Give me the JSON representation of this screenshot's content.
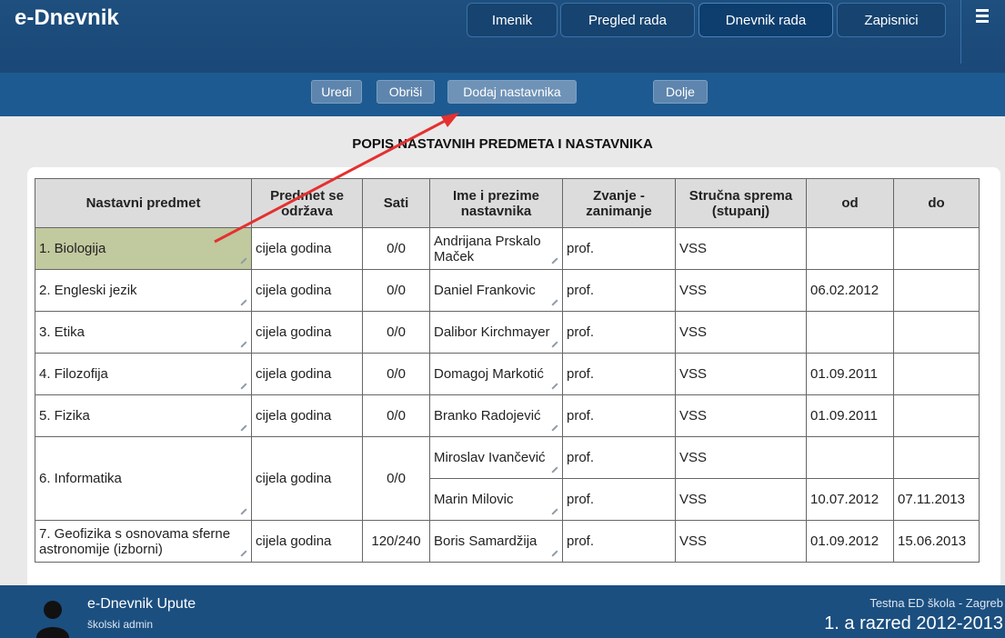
{
  "app": {
    "title": "e-Dnevnik"
  },
  "nav": {
    "imenik": "Imenik",
    "pregled": "Pregled rada",
    "dnevnik": "Dnevnik rada",
    "zapisnici": "Zapisnici"
  },
  "toolbar": {
    "uredi": "Uredi",
    "obrisi": "Obriši",
    "dodaj": "Dodaj nastavnika",
    "dolje": "Dolje"
  },
  "page": {
    "title": "POPIS NASTAVNIH PREDMETA I NASTAVNIKA"
  },
  "table": {
    "headers": [
      "Nastavni predmet",
      "Predmet se održava",
      "Sati",
      "Ime i prezime nastavnika",
      "Zvanje - zanimanje",
      "Stručna sprema (stupanj)",
      "od",
      "do"
    ],
    "rows": [
      {
        "subject": "1. Biologija",
        "held": "cijela godina",
        "hours": "0/0",
        "teacher": "Andrijana Prskalo Maček",
        "title": "prof.",
        "degree": "VSS",
        "from": "",
        "to": ""
      },
      {
        "subject": "2. Engleski jezik",
        "held": "cijela godina",
        "hours": "0/0",
        "teacher": "Daniel Frankovic",
        "title": "prof.",
        "degree": "VSS",
        "from": "06.02.2012",
        "to": ""
      },
      {
        "subject": "3. Etika",
        "held": "cijela godina",
        "hours": "0/0",
        "teacher": "Dalibor Kirchmayer",
        "title": "prof.",
        "degree": "VSS",
        "from": "",
        "to": ""
      },
      {
        "subject": "4. Filozofija",
        "held": "cijela godina",
        "hours": "0/0",
        "teacher": "Domagoj Markotić",
        "title": "prof.",
        "degree": "VSS",
        "from": "01.09.2011",
        "to": ""
      },
      {
        "subject": "5. Fizika",
        "held": "cijela godina",
        "hours": "0/0",
        "teacher": "Branko Radojević",
        "title": "prof.",
        "degree": "VSS",
        "from": "01.09.2011",
        "to": ""
      },
      {
        "subject": "6. Informatika",
        "held": "cijela godina",
        "hours": "0/0",
        "teacher": "Miroslav Ivančević",
        "title": "prof.",
        "degree": "VSS",
        "from": "",
        "to": ""
      },
      {
        "teacher": "Marin Milovic",
        "title": "prof.",
        "degree": "VSS",
        "from": "10.07.2012",
        "to": "07.11.2013"
      },
      {
        "subject": "7. Geofizika s osnovama sferne astronomije (izborni)",
        "held": "cijela godina",
        "hours": "120/240",
        "teacher": "Boris Samardžija",
        "title": "prof.",
        "degree": "VSS",
        "from": "01.09.2012",
        "to": "15.06.2013"
      }
    ]
  },
  "footer": {
    "title": "e-Dnevnik Upute",
    "user": "školski admin",
    "school": "Testna ED škola - Zagreb",
    "class_year": "1. a razred 2012-2013"
  },
  "colors": {
    "header": "#1e4f7e",
    "toolbar": "#1d5a91",
    "highlight": "#c1c99e",
    "annotation": "#e53030"
  },
  "icons": [
    "menu-icon",
    "pencil-icon",
    "avatar-icon",
    "arrow-annotation"
  ]
}
